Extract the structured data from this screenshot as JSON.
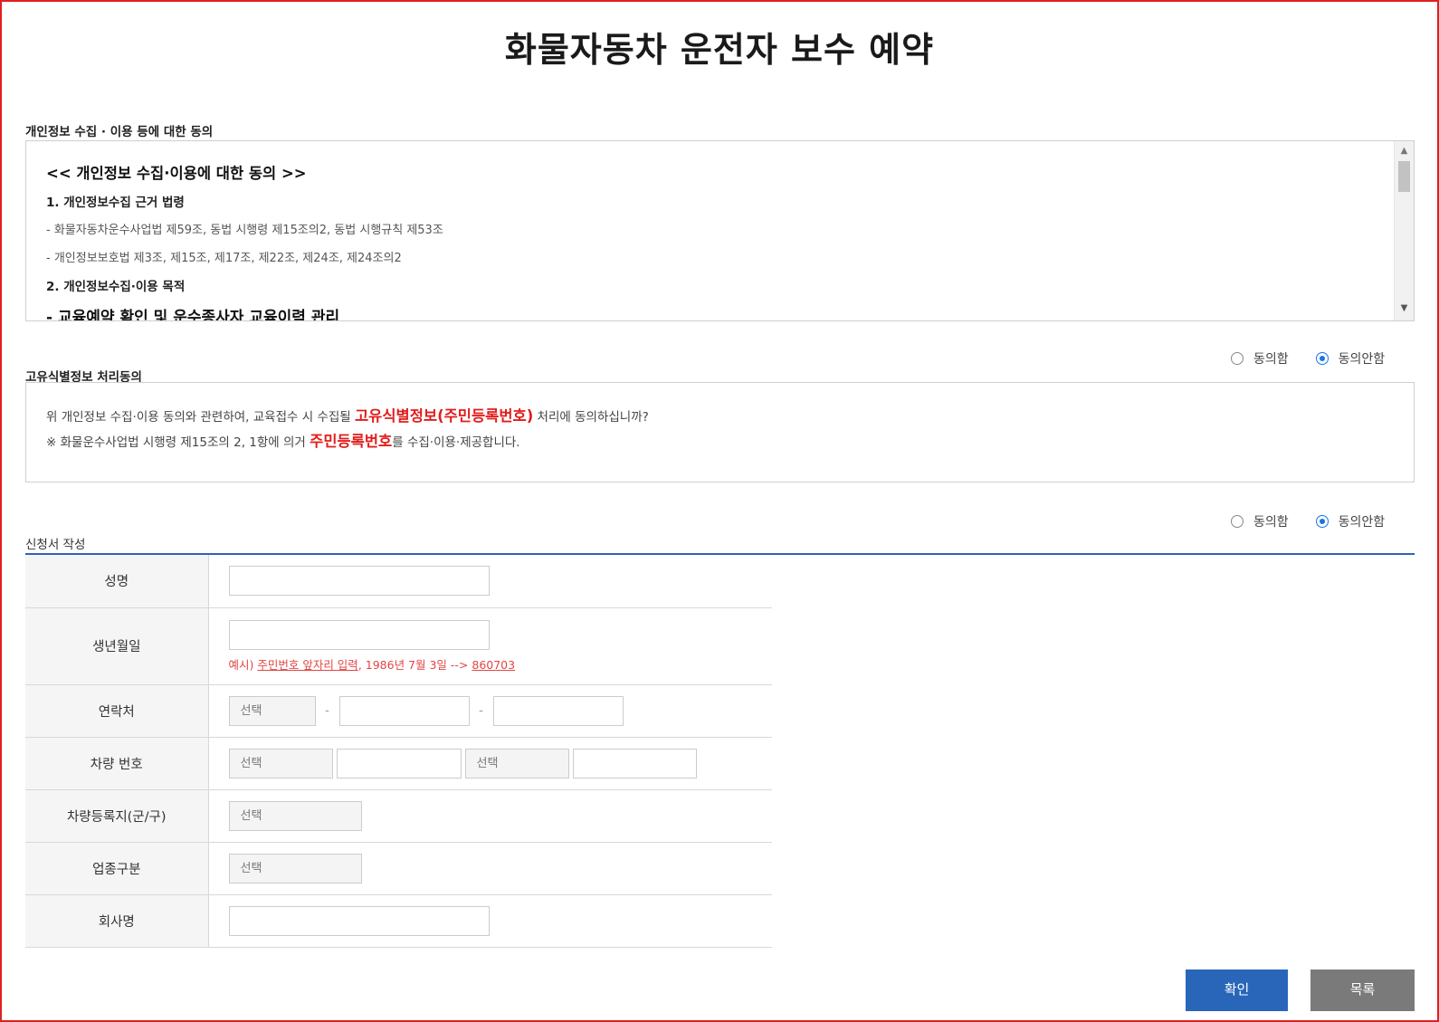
{
  "page": {
    "title": "화물자동차 운전자 보수 예약"
  },
  "consent": {
    "section_label": "개인정보 수집 · 이용 등에 대한 동의",
    "heading": "<< 개인정보 수집·이용에 대한 동의 >>",
    "item1_title": "1. 개인정보수집 근거 법령",
    "item1_line1": "- 화물자동차운수사업법 제59조, 동법 시행령 제15조의2, 동법 시행규칙 제53조",
    "item1_line2": "- 개인정보보호법 제3조, 제15조, 제17조, 제22조, 제24조, 제24조의2",
    "item2_title": "2. 개인정보수집·이용 목적",
    "item2_purpose_prefix": "- ",
    "item2_purpose": "교육예약 확인 및 운수종사자 교육이력 관리",
    "agree_label": "동의함",
    "disagree_label": "동의안함",
    "selected": "동의안함"
  },
  "unique_id": {
    "section_label": "고유식별정보 처리동의",
    "line1_prefix": "위 개인정보 수집·이용 동의와 관련하여, 교육접수 시 수집될 ",
    "line1_highlight": "고유식별정보(주민등록번호)",
    "line1_suffix": " 처리에 동의하십니까?",
    "line2_prefix": "※ 화물운수사업법 시행령 제15조의 2, 1항에 의거 ",
    "line2_highlight": "주민등록번호",
    "line2_suffix": "를 수집·이용·제공합니다.",
    "agree_label": "동의함",
    "disagree_label": "동의안함",
    "selected": "동의안함"
  },
  "form": {
    "section_label": "신청서 작성",
    "name_label": "성명",
    "birth_label": "생년월일",
    "birth_hint_1": "예시) ",
    "birth_hint_2": "주민번호 앞자리 입력",
    "birth_hint_3": ", 1986년 7월 3일 --> ",
    "birth_hint_4": "860703",
    "phone_label": "연락처",
    "phone_select": "선택",
    "phone_sep": "-",
    "vehicle_label": "차량 번호",
    "vehicle_select_1": "선택",
    "vehicle_select_2": "선택",
    "region_label": "차량등록지(군/구)",
    "region_select": "선택",
    "business_label": "업종구분",
    "business_select": "선택",
    "company_label": "회사명"
  },
  "buttons": {
    "confirm": "확인",
    "list": "목록"
  },
  "colors": {
    "primary": "#2966b9",
    "accent_red": "#e31c1c",
    "radio_blue": "#1a73e8",
    "frame_red": "#e02020"
  }
}
